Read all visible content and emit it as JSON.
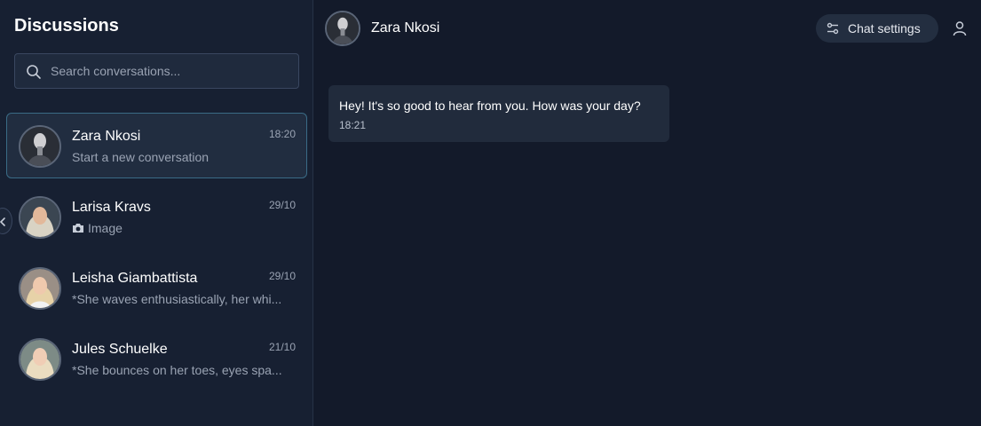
{
  "sidebar": {
    "title": "Discussions",
    "search": {
      "placeholder": "Search conversations...",
      "value": ""
    },
    "conversations": [
      {
        "name": "Zara Nkosi",
        "preview": "Start a new conversation",
        "time": "18:20",
        "active": true
      },
      {
        "name": "Larisa Kravs",
        "preview": "Image",
        "time": "29/10",
        "preview_icon": "camera-icon"
      },
      {
        "name": "Leisha Giambattista",
        "preview": "*She waves enthusiastically, her whi...",
        "time": "29/10"
      },
      {
        "name": "Jules Schuelke",
        "preview": "*She bounces on her toes, eyes spa...",
        "time": "21/10"
      }
    ]
  },
  "chat": {
    "header": {
      "name": "Zara Nkosi",
      "settings_label": "Chat settings"
    },
    "messages": [
      {
        "text": "Hey! It's so good to hear from you. How was your day?",
        "time": "18:21"
      }
    ]
  },
  "icons": [
    "search-icon",
    "camera-icon",
    "sliders-icon",
    "user-icon",
    "chevron-left-icon"
  ],
  "colors": {
    "background": "#131a2a",
    "sidebar": "#172032",
    "active_border": "#3a6b86",
    "bubble": "#212b3c"
  }
}
